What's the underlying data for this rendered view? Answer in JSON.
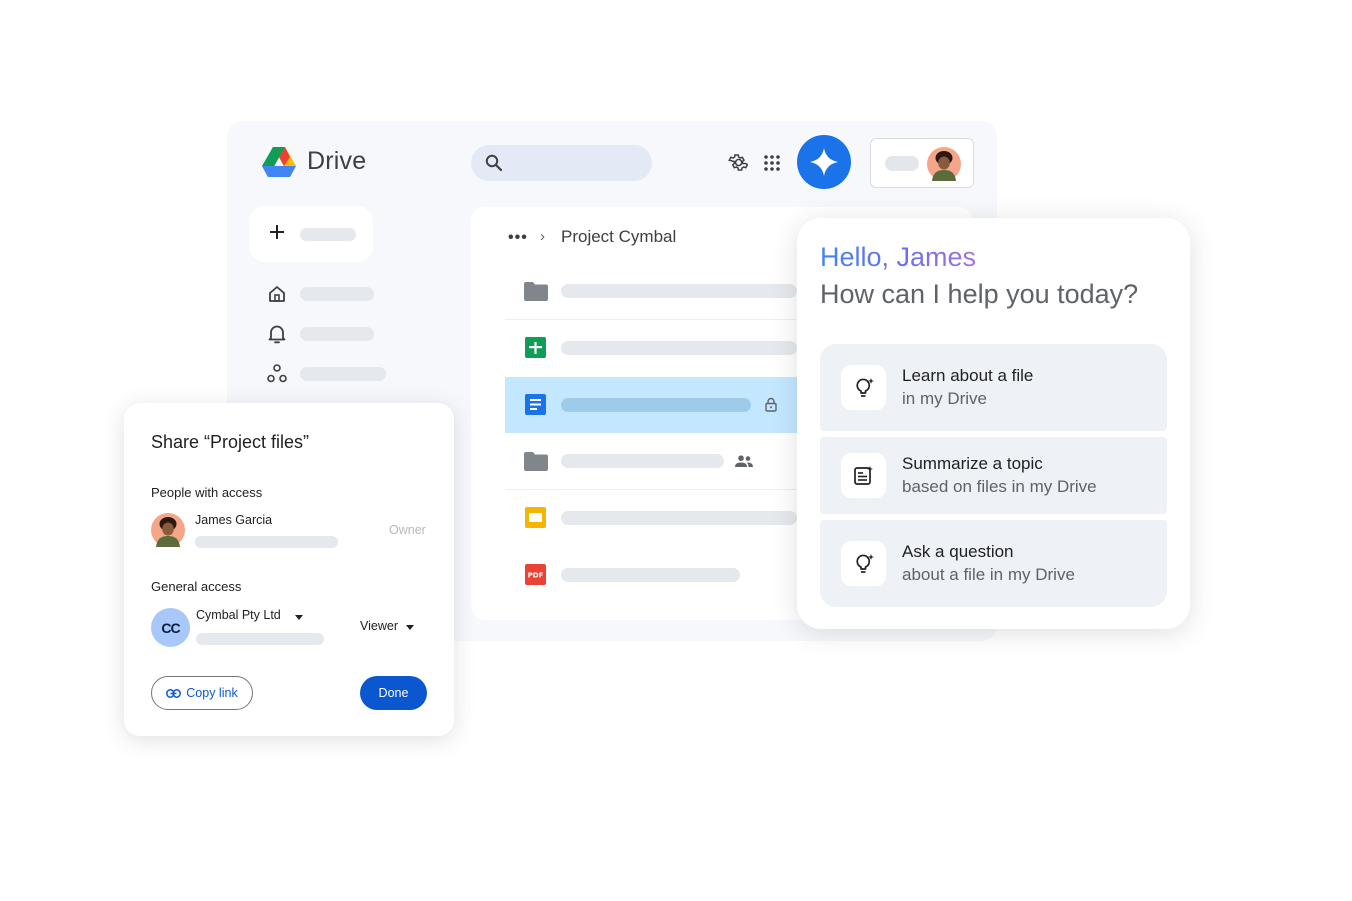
{
  "app": {
    "title": "Drive",
    "colors": {
      "accent": "#1a73e8",
      "selected_row": "#c2e7ff",
      "window_bg": "#f6f8fc"
    }
  },
  "header": {
    "search_icon": "search-icon",
    "settings_icon": "gear-icon",
    "apps_icon": "apps-grid-icon",
    "gemini_icon": "gemini-sparkle-icon"
  },
  "sidebar": {
    "new_icon": "plus-icon",
    "items": [
      {
        "icon": "home-icon"
      },
      {
        "icon": "bell-icon"
      },
      {
        "icon": "shared-icon"
      }
    ]
  },
  "breadcrumb": {
    "more": "•••",
    "separator": "›",
    "current": "Project Cymbal"
  },
  "files": [
    {
      "icon": "folder-icon",
      "selected": false,
      "badge": ""
    },
    {
      "icon": "sheets-icon",
      "selected": false,
      "badge": ""
    },
    {
      "icon": "docs-icon",
      "selected": true,
      "badge": "lock-icon"
    },
    {
      "icon": "folder-icon",
      "selected": false,
      "badge": "people-icon"
    },
    {
      "icon": "slides-icon",
      "selected": false,
      "badge": ""
    },
    {
      "icon": "pdf-icon",
      "selected": false,
      "badge": ""
    }
  ],
  "share_dialog": {
    "title": "Share “Project files”",
    "people_label": "People with access",
    "person_name": "James Garcia",
    "person_role": "Owner",
    "general_label": "General access",
    "org_initials": "CC",
    "org_name": "Cymbal Pty Ltd",
    "role": "Viewer",
    "copy_link_label": "Copy link",
    "done_label": "Done",
    "pdf_label": "PDF"
  },
  "gemini": {
    "greeting": "Hello, James",
    "prompt": "How can I help you today?",
    "suggestions": [
      {
        "icon": "lightbulb-sparkle-icon",
        "title": "Learn about a file",
        "subtitle": "in my Drive"
      },
      {
        "icon": "summarize-icon",
        "title": "Summarize a topic",
        "subtitle": "based on files in my Drive"
      },
      {
        "icon": "lightbulb-sparkle-icon",
        "title": "Ask a question",
        "subtitle": "about a file in my Drive"
      }
    ]
  }
}
